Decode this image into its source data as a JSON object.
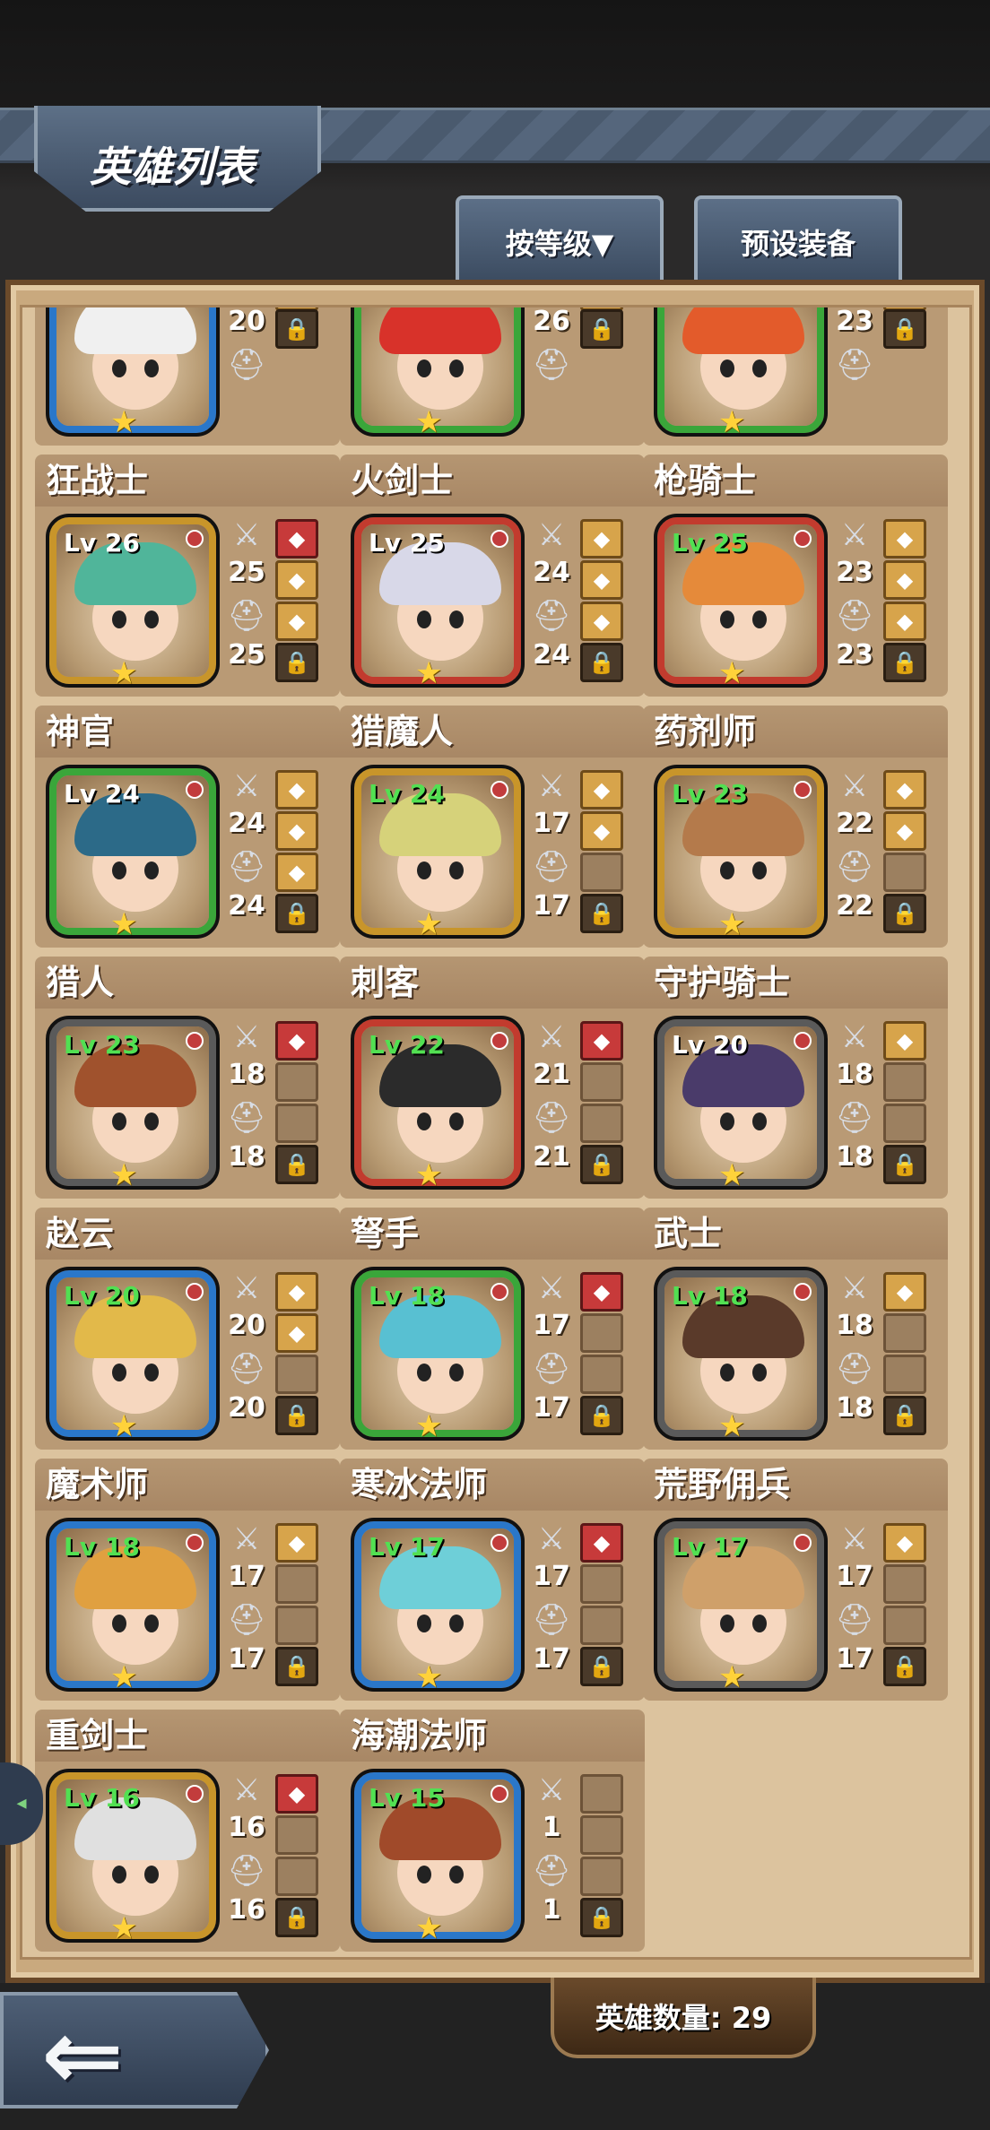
{
  "header": {
    "title": "英雄列表",
    "sort_label": "按等级▼",
    "preset_label": "预设装备"
  },
  "footer": {
    "count_label": "英雄数量: 29",
    "back": "back-arrow-icon"
  },
  "colors": {
    "green": "#3aa63a",
    "red": "#c23b2e",
    "blue": "#2a77c9",
    "gold": "#c8952a",
    "gray": "#5a5a5a",
    "lv_green": "#52e052",
    "lv_white": "#ffffff"
  },
  "heroes": [
    {
      "name": "",
      "lv": "",
      "atk": "20",
      "def": "",
      "frame": "blue",
      "lvcolor": "white",
      "slots": [
        "filled",
        "lock"
      ],
      "partial": true
    },
    {
      "name": "",
      "lv": "",
      "atk": "26",
      "def": "",
      "frame": "green",
      "lvcolor": "white",
      "slots": [
        "filled",
        "lock"
      ],
      "partial": true
    },
    {
      "name": "",
      "lv": "",
      "atk": "23",
      "def": "",
      "frame": "green",
      "lvcolor": "white",
      "slots": [
        "filled",
        "lock"
      ],
      "partial": true
    },
    {
      "name": "狂战士",
      "lv": "Lv 26",
      "atk": "25",
      "def": "25",
      "frame": "gold",
      "lvcolor": "white",
      "slots": [
        "red",
        "filled",
        "filled",
        "lock"
      ]
    },
    {
      "name": "火剑士",
      "lv": "Lv 25",
      "atk": "24",
      "def": "24",
      "frame": "red",
      "lvcolor": "white",
      "slots": [
        "filled",
        "filled",
        "filled",
        "lock"
      ]
    },
    {
      "name": "枪骑士",
      "lv": "Lv 25",
      "atk": "23",
      "def": "23",
      "frame": "red",
      "lvcolor": "green",
      "slots": [
        "filled",
        "filled",
        "filled",
        "lock"
      ]
    },
    {
      "name": "神官",
      "lv": "Lv 24",
      "atk": "24",
      "def": "24",
      "frame": "green",
      "lvcolor": "white",
      "slots": [
        "filled",
        "filled",
        "filled",
        "lock"
      ]
    },
    {
      "name": "猎魔人",
      "lv": "Lv 24",
      "atk": "17",
      "def": "17",
      "frame": "gold",
      "lvcolor": "green",
      "slots": [
        "filled",
        "filled",
        "empty",
        "lock"
      ]
    },
    {
      "name": "药剂师",
      "lv": "Lv 23",
      "atk": "22",
      "def": "22",
      "frame": "gold",
      "lvcolor": "green",
      "slots": [
        "filled",
        "filled",
        "empty",
        "lock"
      ]
    },
    {
      "name": "猎人",
      "lv": "Lv 23",
      "atk": "18",
      "def": "18",
      "frame": "gray",
      "lvcolor": "green",
      "slots": [
        "red",
        "empty",
        "empty",
        "lock"
      ]
    },
    {
      "name": "刺客",
      "lv": "Lv 22",
      "atk": "21",
      "def": "21",
      "frame": "red",
      "lvcolor": "green",
      "slots": [
        "red",
        "empty",
        "empty",
        "lock"
      ]
    },
    {
      "name": "守护骑士",
      "lv": "Lv 20",
      "atk": "18",
      "def": "18",
      "frame": "gray",
      "lvcolor": "white",
      "slots": [
        "filled",
        "empty",
        "empty",
        "lock"
      ]
    },
    {
      "name": "赵云",
      "lv": "Lv 20",
      "atk": "20",
      "def": "20",
      "frame": "blue",
      "lvcolor": "green",
      "slots": [
        "filled",
        "filled",
        "empty",
        "lock"
      ]
    },
    {
      "name": "弩手",
      "lv": "Lv 18",
      "atk": "17",
      "def": "17",
      "frame": "green",
      "lvcolor": "green",
      "slots": [
        "red",
        "empty",
        "empty",
        "lock"
      ]
    },
    {
      "name": "武士",
      "lv": "Lv 18",
      "atk": "18",
      "def": "18",
      "frame": "gray",
      "lvcolor": "green",
      "slots": [
        "filled",
        "empty",
        "empty",
        "lock"
      ]
    },
    {
      "name": "魔术师",
      "lv": "Lv 18",
      "atk": "17",
      "def": "17",
      "frame": "blue",
      "lvcolor": "green",
      "slots": [
        "filled",
        "empty",
        "empty",
        "lock"
      ]
    },
    {
      "name": "寒冰法师",
      "lv": "Lv 17",
      "atk": "17",
      "def": "17",
      "frame": "blue",
      "lvcolor": "green",
      "slots": [
        "red",
        "empty",
        "empty",
        "lock"
      ]
    },
    {
      "name": "荒野佣兵",
      "lv": "Lv 17",
      "atk": "17",
      "def": "17",
      "frame": "gray",
      "lvcolor": "green",
      "slots": [
        "filled",
        "empty",
        "empty",
        "lock"
      ]
    },
    {
      "name": "重剑士",
      "lv": "Lv 16",
      "atk": "16",
      "def": "16",
      "frame": "gold",
      "lvcolor": "green",
      "slots": [
        "red",
        "empty",
        "empty",
        "lock"
      ]
    },
    {
      "name": "海潮法师",
      "lv": "Lv 15",
      "atk": "1",
      "def": "1",
      "frame": "blue",
      "lvcolor": "green",
      "slots": [
        "empty",
        "empty",
        "empty",
        "lock"
      ]
    }
  ],
  "icons": {
    "attack": "sword-icon",
    "defense": "helmet-icon",
    "lock": "lock-icon",
    "star": "star-icon"
  }
}
